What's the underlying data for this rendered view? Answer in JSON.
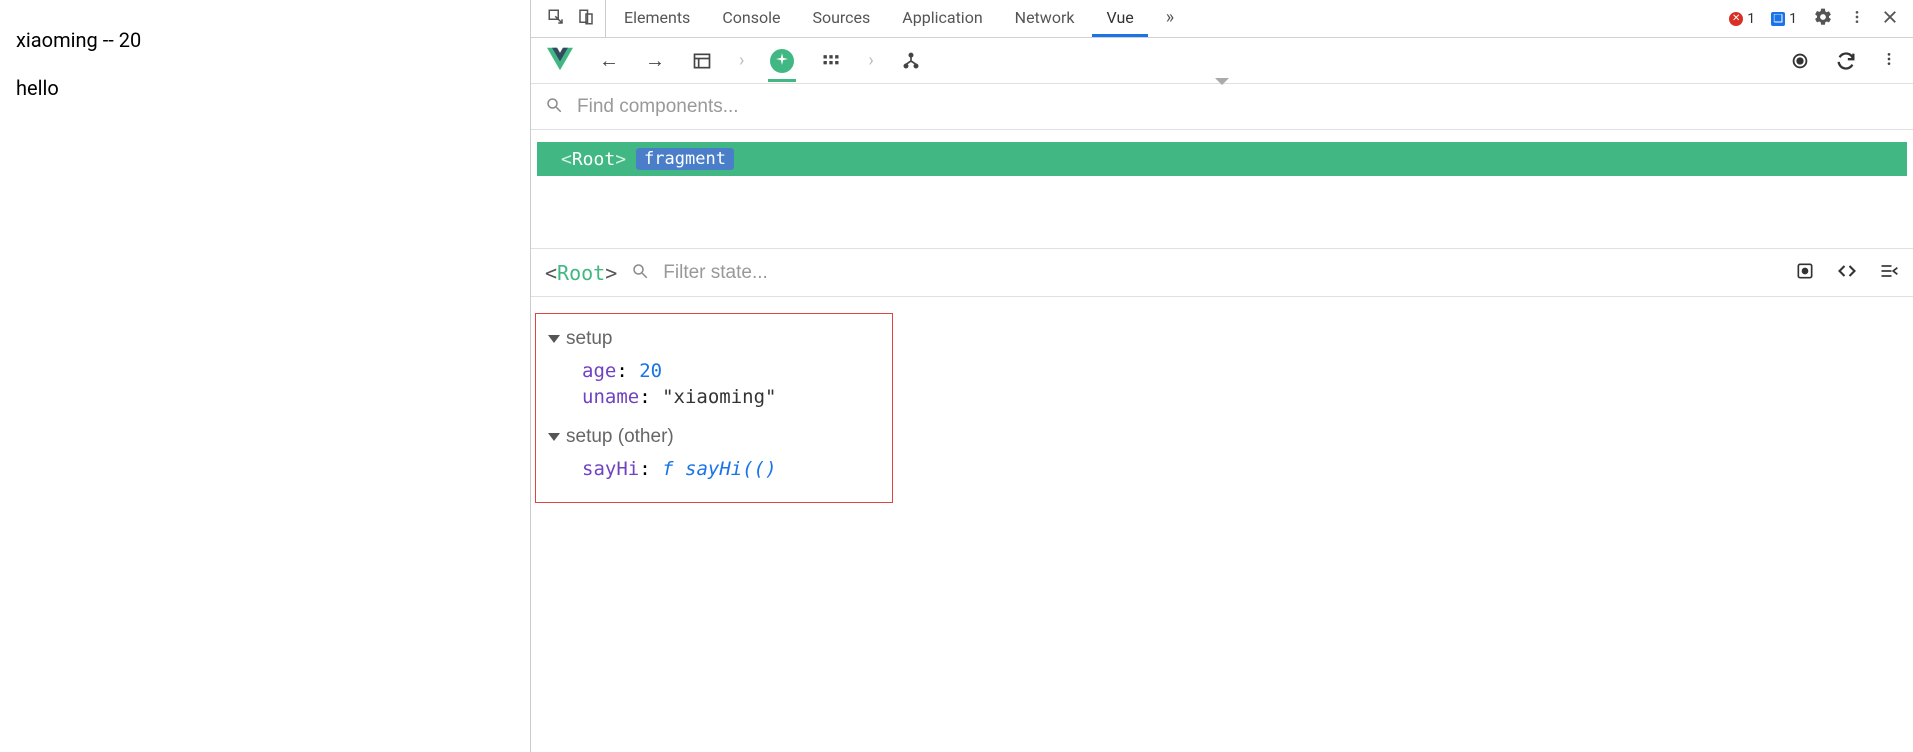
{
  "page": {
    "line1": "xiaoming -- 20",
    "line2": "hello"
  },
  "devtools": {
    "tabs": [
      "Elements",
      "Console",
      "Sources",
      "Application",
      "Network",
      "Vue"
    ],
    "activeTab": "Vue",
    "more": "»",
    "errorCount": "1",
    "infoCount": "1"
  },
  "search": {
    "placeholder": "Find components..."
  },
  "tree": {
    "rootOpen": "<",
    "rootName": "Root",
    "rootClose": ">",
    "badge": "fragment"
  },
  "stateHeader": {
    "open": "<",
    "name": "Root",
    "close": ">",
    "filterPlaceholder": "Filter state..."
  },
  "state": {
    "section1": "setup",
    "age_key": "age",
    "age_val": "20",
    "uname_key": "uname",
    "uname_val": "\"xiaoming\"",
    "section2": "setup (other)",
    "sayhi_key": "sayHi",
    "sayhi_f": "f",
    "sayhi_sig": "sayHi(()"
  }
}
